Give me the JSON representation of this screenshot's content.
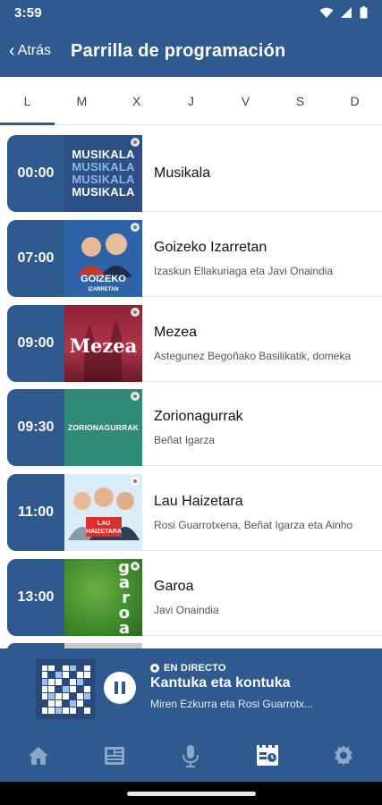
{
  "status_bar": {
    "time": "3:59"
  },
  "app_bar": {
    "back_label": "Atrás",
    "title": "Parrilla de programación"
  },
  "day_tabs": [
    {
      "label": "L",
      "active": true
    },
    {
      "label": "M"
    },
    {
      "label": "X"
    },
    {
      "label": "J"
    },
    {
      "label": "V"
    },
    {
      "label": "S"
    },
    {
      "label": "D"
    }
  ],
  "programs": [
    {
      "time": "00:00",
      "title": "Musikala",
      "subtitle": "",
      "thumb_text": [
        "MUSIKALA",
        "MUSIKALA",
        "MUSIKALA",
        "MUSIKALA"
      ]
    },
    {
      "time": "07:00",
      "title": "Goizeko Izarretan",
      "subtitle": "Izaskun Ellakuriaga eta Javi Onaindia",
      "thumb_text": [
        "GOIZEKO",
        "IZARRETAN"
      ]
    },
    {
      "time": "09:00",
      "title": "Mezea",
      "subtitle": "Astegunez Begoñako Basilikatik, domeka",
      "thumb_text": [
        "Mezea"
      ]
    },
    {
      "time": "09:30",
      "title": "Zorionagurrak",
      "subtitle": "Beñat Igarza",
      "thumb_text": [
        "ZORIONAGURRAK"
      ]
    },
    {
      "time": "11:00",
      "title": "Lau Haizetara",
      "subtitle": "Rosi Guarrotxena, Beñat Igarza eta Ainho",
      "thumb_text": [
        "LAU",
        "HAIZETARA"
      ]
    },
    {
      "time": "13:00",
      "title": "Garoa",
      "subtitle": "Javi Onaindia",
      "thumb_text": [
        "g",
        "a",
        "r",
        "o",
        "a"
      ]
    }
  ],
  "now_playing": {
    "live_label": "EN DIRECTO",
    "title": "Kantuka eta kontuka",
    "subtitle": "Miren Ezkurra eta Rosi Guarrotx..."
  },
  "bottom_nav": [
    {
      "icon": "home-icon"
    },
    {
      "icon": "news-icon"
    },
    {
      "icon": "microphone-icon"
    },
    {
      "icon": "schedule-icon",
      "active": true
    },
    {
      "icon": "settings-icon"
    }
  ],
  "colors": {
    "primary": "#2f5a8f",
    "nav_icon_inactive": "#8aa6c9",
    "nav_icon_active": "#ffffff"
  }
}
